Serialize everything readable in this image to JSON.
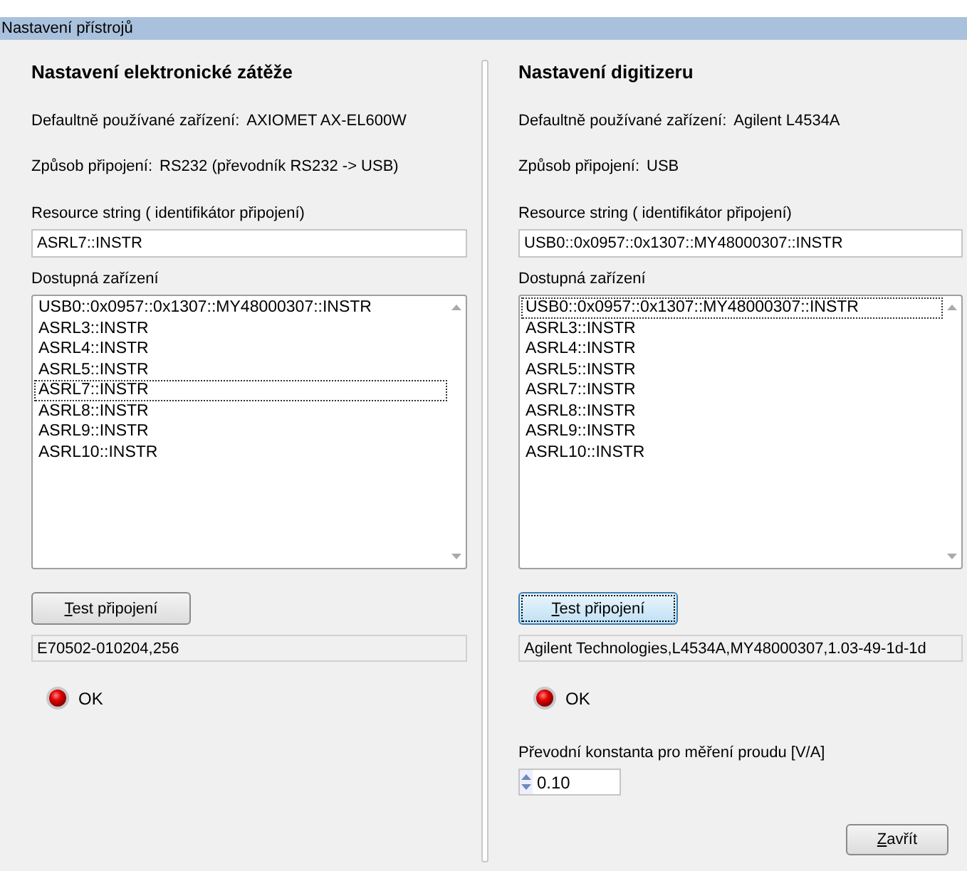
{
  "window": {
    "title": "Nastavení přístrojů"
  },
  "panels": [
    {
      "heading": "Nastavení elektronické zátěže",
      "info": [
        {
          "label": "Defaultně používané zařízení:",
          "value": "AXIOMET AX-EL600W"
        },
        {
          "label": "Způsob připojení:",
          "value": "RS232  (převodník RS232 -> USB)"
        }
      ],
      "resource_label": "Resource string ( identifikátor připojení)",
      "resource_value": "ASRL7::INSTR",
      "list_label": "Dostupná zařízení",
      "devices": [
        {
          "name": "USB0::0x0957::0x1307::MY48000307::INSTR",
          "selected": false
        },
        {
          "name": "ASRL3::INSTR",
          "selected": false
        },
        {
          "name": "ASRL4::INSTR",
          "selected": false
        },
        {
          "name": "ASRL5::INSTR",
          "selected": false
        },
        {
          "name": "ASRL7::INSTR",
          "selected": true
        },
        {
          "name": "ASRL8::INSTR",
          "selected": false
        },
        {
          "name": "ASRL9::INSTR",
          "selected": false
        },
        {
          "name": "ASRL10::INSTR",
          "selected": false
        }
      ],
      "test_button": {
        "label": "Test připojení",
        "focused": false
      },
      "response": "E70502-010204,256",
      "status": "OK"
    },
    {
      "heading": "Nastavení digitizeru",
      "info": [
        {
          "label": "Defaultně používané zařízení:",
          "value": "Agilent L4534A"
        },
        {
          "label": "Způsob připojení:",
          "value": "USB"
        }
      ],
      "resource_label": "Resource string ( identifikátor připojení)",
      "resource_value": "USB0::0x0957::0x1307::MY48000307::INSTR",
      "list_label": "Dostupná zařízení",
      "devices": [
        {
          "name": "USB0::0x0957::0x1307::MY48000307::INSTR",
          "selected": true
        },
        {
          "name": "ASRL3::INSTR",
          "selected": false
        },
        {
          "name": "ASRL4::INSTR",
          "selected": false
        },
        {
          "name": "ASRL5::INSTR",
          "selected": false
        },
        {
          "name": "ASRL7::INSTR",
          "selected": false
        },
        {
          "name": "ASRL8::INSTR",
          "selected": false
        },
        {
          "name": "ASRL9::INSTR",
          "selected": false
        },
        {
          "name": "ASRL10::INSTR",
          "selected": false
        }
      ],
      "test_button": {
        "label": "Test připojení",
        "focused": true
      },
      "response": "Agilent Technologies,L4534A,MY48000307,1.03-49-1d-1d",
      "status": "OK",
      "constant": {
        "label": "Převodní konstanta pro měření proudu [V/A]",
        "value": "0.10"
      }
    }
  ],
  "close_button": "Zavřít"
}
